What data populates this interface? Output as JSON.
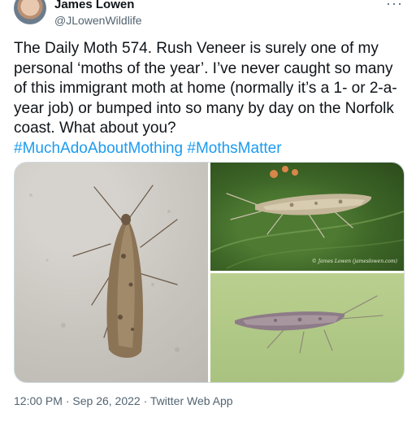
{
  "author": {
    "name": "James Lowen",
    "handle": "@JLowenWildlife"
  },
  "more_menu": "···",
  "tweet": {
    "text": "The Daily Moth 574. Rush Veneer is surely one of my personal ‘moths of the year’. I’ve never caught so many of this immigrant moth at home (normally it’s a 1- or 2-a-year job) or bumped into so many by day on the Norfolk coast. What about you?",
    "hashtags": [
      "#MuchAdoAboutMothing",
      "#MothsMatter"
    ]
  },
  "media": {
    "photo_credit": "© James Lowen (jameslowen.com)"
  },
  "meta": {
    "time": "12:00 PM",
    "separator": " · ",
    "date": "Sep 26, 2022",
    "app": "Twitter Web App"
  }
}
